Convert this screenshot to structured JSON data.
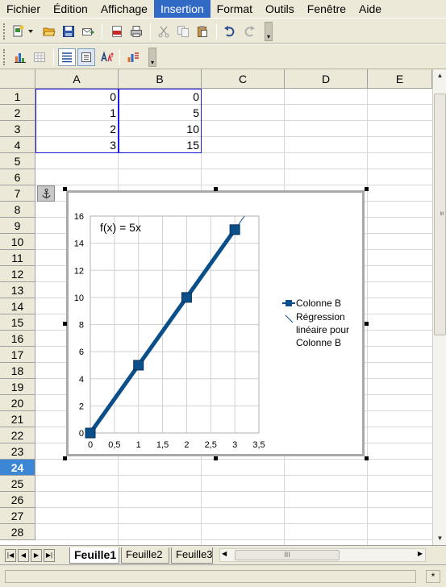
{
  "menu": [
    {
      "label": "Fichier",
      "active": false
    },
    {
      "label": "Édition",
      "active": false
    },
    {
      "label": "Affichage",
      "active": false
    },
    {
      "label": "Insertion",
      "active": true
    },
    {
      "label": "Format",
      "active": false
    },
    {
      "label": "Outils",
      "active": false
    },
    {
      "label": "Fenêtre",
      "active": false
    },
    {
      "label": "Aide",
      "active": false
    }
  ],
  "toolbar1_icons": [
    "new-document-icon",
    "dropdown-arrow-icon",
    "open-folder-icon",
    "save-icon",
    "email-icon",
    "export-pdf-icon",
    "print-icon",
    "cut-icon",
    "copy-icon",
    "paste-icon",
    "undo-icon",
    "redo-icon"
  ],
  "toolbar2_icons": [
    "chart-type-icon",
    "data-table-icon",
    "data-in-rows-icon",
    "data-in-columns-icon",
    "scale-text-icon",
    "automatic-layout-icon"
  ],
  "columns": [
    "A",
    "B",
    "C",
    "D",
    "E"
  ],
  "rows": [
    "1",
    "2",
    "3",
    "4",
    "5",
    "6",
    "7",
    "8",
    "9",
    "10",
    "11",
    "12",
    "13",
    "14",
    "15",
    "16",
    "17",
    "18",
    "19",
    "20",
    "21",
    "22",
    "23",
    "24",
    "25",
    "26",
    "27",
    "28"
  ],
  "selected_row": "24",
  "cells": {
    "A": [
      "0",
      "1",
      "2",
      "3"
    ],
    "B": [
      "0",
      "5",
      "10",
      "15"
    ]
  },
  "sheet_tabs": [
    {
      "label": "Feuille1",
      "active": true
    },
    {
      "label": "Feuille2",
      "active": false
    },
    {
      "label": "Feuille3",
      "active": false
    }
  ],
  "status_star": "*",
  "colors": {
    "accent": "#316ac5",
    "series": "#0b4f8a",
    "selection": "#1a1adb",
    "row_select": "#3c86d6"
  },
  "chart_data": {
    "type": "line",
    "x": [
      0,
      1,
      2,
      3
    ],
    "series": [
      {
        "name": "Colonne B",
        "values": [
          0,
          5,
          10,
          15
        ]
      }
    ],
    "trendline": {
      "name": "Régression linéaire pour Colonne B",
      "equation": "f(x) = 5x",
      "kind": "linear"
    },
    "xlim": [
      0,
      3.5
    ],
    "ylim": [
      0,
      16
    ],
    "x_ticks": [
      "0",
      "0,5",
      "1",
      "1,5",
      "2",
      "2,5",
      "3",
      "3,5"
    ],
    "y_ticks": [
      "0",
      "2",
      "4",
      "6",
      "8",
      "10",
      "12",
      "14",
      "16"
    ],
    "grid": true,
    "legend": "right",
    "legend_entries": [
      "Colonne B",
      "Régression linéaire pour Colonne B"
    ]
  }
}
